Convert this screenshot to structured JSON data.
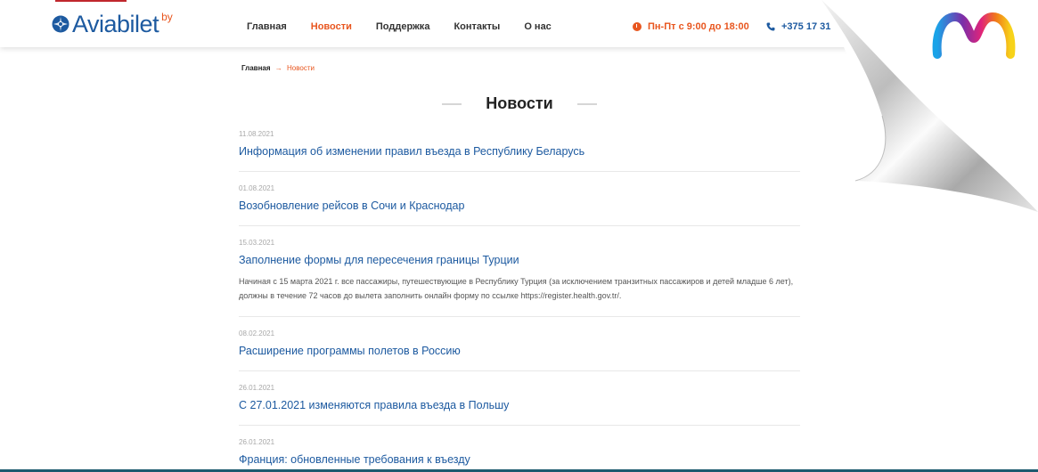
{
  "header": {
    "logo_text": "Aviabilet",
    "logo_sup": "by",
    "nav": [
      "Главная",
      "Новости",
      "Поддержка",
      "Контакты",
      "О нас"
    ],
    "active_nav": "Новости",
    "hours": "Пн-Пт с 9:00 до 18:00",
    "phone": "+375 17 31"
  },
  "breadcrumb": {
    "home": "Главная",
    "separator": "→",
    "current": "Новости"
  },
  "page_title": "Новости",
  "news": [
    {
      "date": "11.08.2021",
      "title": "Информация об изменении правил въезда в Республику Беларусь",
      "text": ""
    },
    {
      "date": "01.08.2021",
      "title": "Возобновление рейсов в Сочи и Краснодар",
      "text": ""
    },
    {
      "date": "15.03.2021",
      "title": "Заполнение формы для пересечения границы Турции",
      "text": "Начиная с 15 марта 2021 г. все пассажиры, путешествующие в Республику Турция (за исключением транзитных пассажиров и детей младше 6 лет), должны в течение 72 часов до вылета заполнить онлайн форму по ссылке https://register.health.gov.tr/."
    },
    {
      "date": "08.02.2021",
      "title": "Расширение программы полетов в Россию",
      "text": ""
    },
    {
      "date": "26.01.2021",
      "title": "С 27.01.2021 изменяются правила въезда в Польшу",
      "text": ""
    },
    {
      "date": "26.01.2021",
      "title": "Франция: обновленные требования к въезду",
      "text": ""
    }
  ],
  "colors": {
    "brand_blue": "#1d5aa0",
    "accent_orange": "#e8561f",
    "text_dark": "#222222",
    "date_gray": "#a8a8a8"
  },
  "icons": [
    "logo-icon",
    "clock-icon",
    "phone-icon",
    "page-curl",
    "brand-m-logo"
  ]
}
